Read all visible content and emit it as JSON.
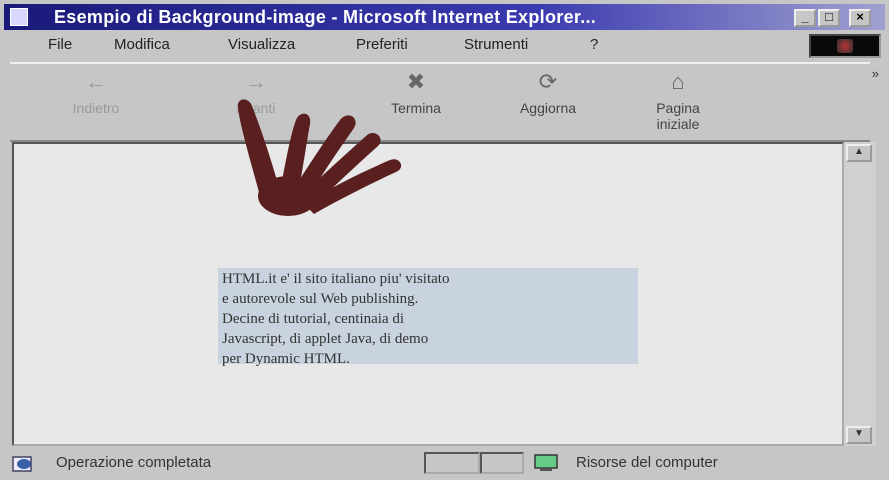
{
  "window": {
    "title": "Esempio di Background-image - Microsoft Internet Explorer...",
    "controls": [
      "_",
      "□",
      "×"
    ]
  },
  "menu": {
    "items": [
      "File",
      "Modifica",
      "Visualizza",
      "Preferiti",
      "Strumenti",
      "?"
    ]
  },
  "toolbar": {
    "back": "Indietro",
    "forward": "Avanti",
    "stop": "Termina",
    "refresh": "Aggiorna",
    "home_line1": "Pagina",
    "home_line2": "iniziale",
    "more": "»"
  },
  "content": {
    "lines": [
      "HTML.it e' il sito italiano piu' visitato",
      "e autorevole sul Web publishing.",
      "Decine di tutorial, centinaia di",
      "Javascript, di applet Java, di demo",
      "per Dynamic HTML."
    ]
  },
  "status": {
    "message": "Operazione completata",
    "zone": "Risorse del computer"
  },
  "colors": {
    "titlebar_start": "#1a1a7a",
    "text_background": "#c9d2df",
    "hand": "#5a1f1f"
  }
}
